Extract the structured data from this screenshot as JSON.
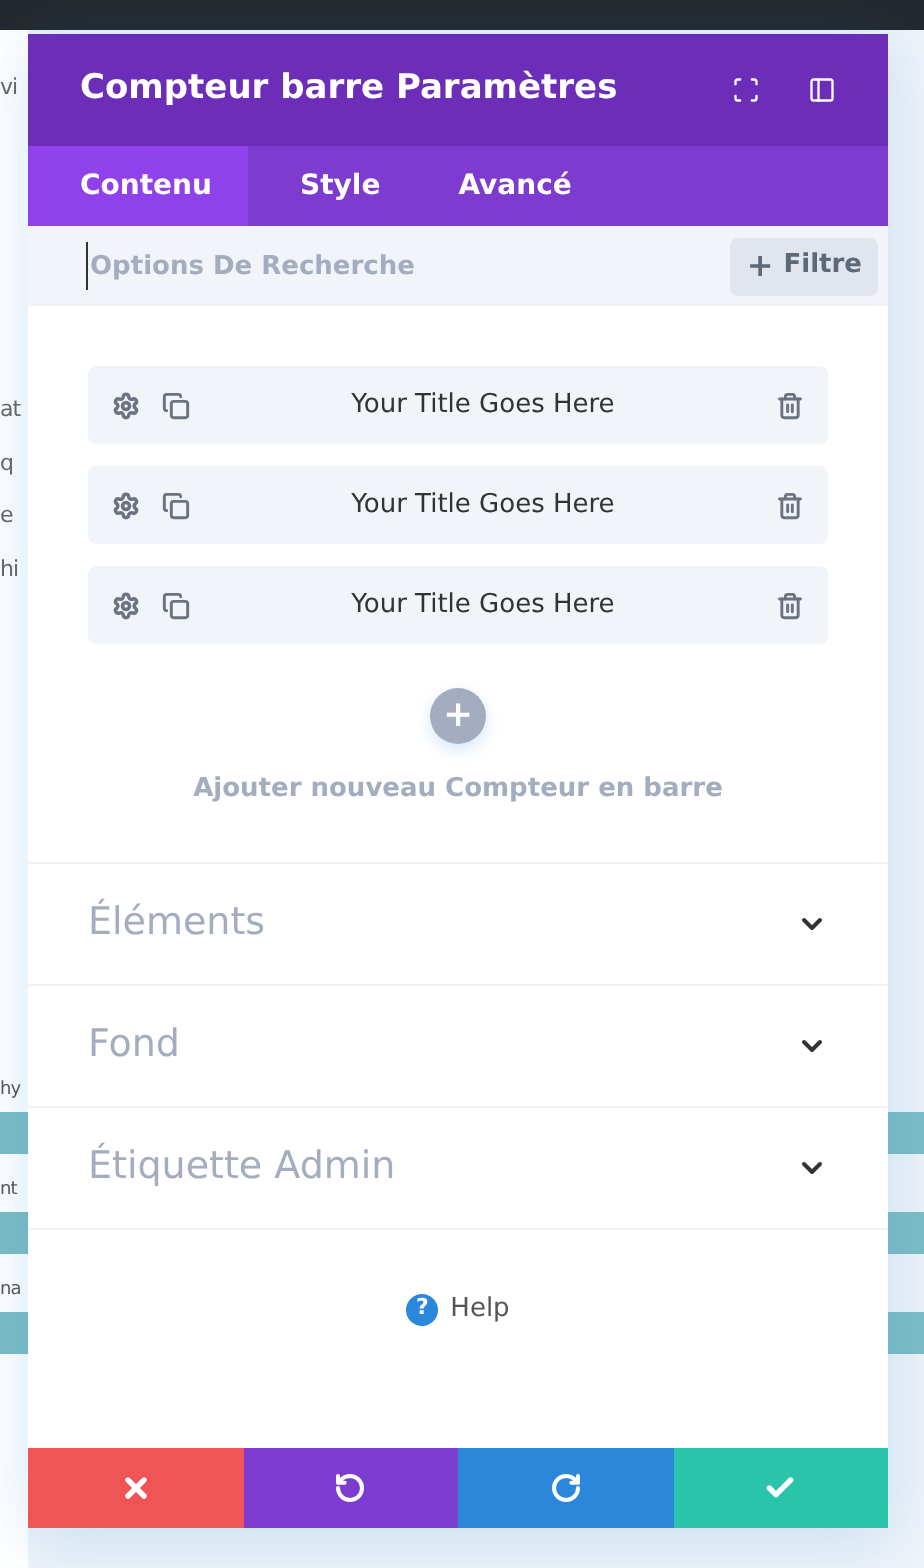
{
  "background_fragments": [
    {
      "text": "vi",
      "kind": "text"
    },
    {
      "text": "at",
      "kind": "text"
    },
    {
      "text": "q",
      "kind": "text"
    },
    {
      "text": "e",
      "kind": "text"
    },
    {
      "text": "hi",
      "kind": "text"
    },
    {
      "text": "hy",
      "kind": "small"
    },
    {
      "text": "nt",
      "kind": "small"
    },
    {
      "text": "na",
      "kind": "small"
    }
  ],
  "panel": {
    "title": "Compteur barre Paramètres",
    "tabs": [
      {
        "label": "Contenu",
        "selected": true
      },
      {
        "label": "Style",
        "selected": false
      },
      {
        "label": "Avancé",
        "selected": false
      }
    ],
    "search": {
      "placeholder": "Options De Recherche"
    },
    "filter_button": {
      "icon": "+",
      "label": "Filtre"
    },
    "items": [
      {
        "title": "Your Title Goes Here"
      },
      {
        "title": "Your Title Goes Here"
      },
      {
        "title": "Your Title Goes Here"
      }
    ],
    "add_label": "Ajouter nouveau Compteur en barre",
    "sections": [
      {
        "label": "Éléments",
        "expanded": false
      },
      {
        "label": "Fond",
        "expanded": false
      },
      {
        "label": "Étiquette Admin",
        "expanded": false
      }
    ],
    "help": {
      "icon": "?",
      "label": "Help"
    },
    "footer_buttons": [
      {
        "kind": "cancel"
      },
      {
        "kind": "undo"
      },
      {
        "kind": "redo"
      },
      {
        "kind": "save"
      }
    ]
  }
}
